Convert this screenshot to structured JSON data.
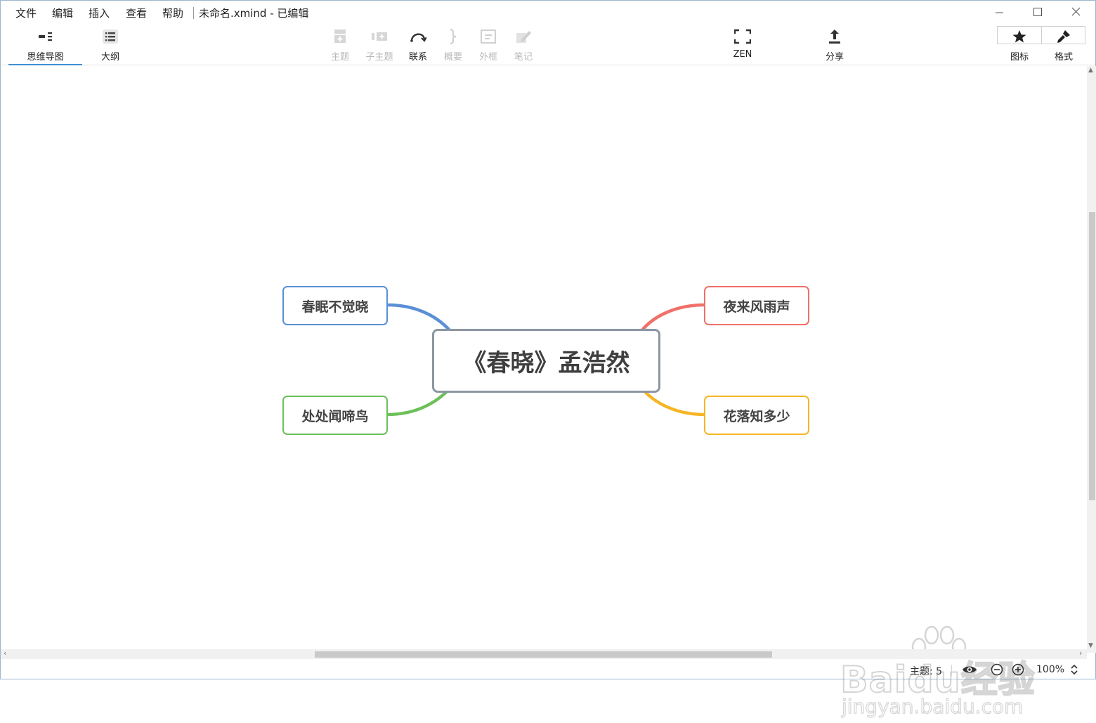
{
  "menubar": {
    "items": [
      "文件",
      "编辑",
      "插入",
      "查看",
      "帮助"
    ],
    "doc_title": "未命名.xmind - 已编辑"
  },
  "toolbar": {
    "view_tabs": [
      {
        "label": "思维导图",
        "icon": "mindmap-view-icon",
        "active": true
      },
      {
        "label": "大纲",
        "icon": "outline-list-icon",
        "active": false
      }
    ],
    "tools": [
      {
        "label": "主题",
        "icon": "add-topic-icon",
        "enabled": false
      },
      {
        "label": "子主题",
        "icon": "add-subtopic-icon",
        "enabled": false
      },
      {
        "label": "联系",
        "icon": "relationship-curve-icon",
        "enabled": true
      },
      {
        "label": "概要",
        "icon": "summary-brace-icon",
        "enabled": false
      },
      {
        "label": "外框",
        "icon": "boundary-icon",
        "enabled": false
      },
      {
        "label": "笔记",
        "icon": "note-pencil-icon",
        "enabled": false
      }
    ],
    "zen": {
      "label": "ZEN",
      "icon": "zen-fullscreen-icon"
    },
    "share": {
      "label": "分享",
      "icon": "share-upload-icon"
    },
    "right": [
      {
        "label": "图标",
        "icon": "star-icon"
      },
      {
        "label": "格式",
        "icon": "paintbrush-icon"
      }
    ]
  },
  "mindmap": {
    "central": "《春晓》孟浩然",
    "branches": [
      {
        "text": "春眠不觉晓",
        "color": "#5b8fd6"
      },
      {
        "text": "处处闻啼鸟",
        "color": "#6cc05a"
      },
      {
        "text": "夜来风雨声",
        "color": "#f0706a"
      },
      {
        "text": "花落知多少",
        "color": "#f6b526"
      }
    ]
  },
  "statusbar": {
    "topic_count": "主题: 5",
    "zoom": "100%"
  },
  "watermark": {
    "brand": "Baidu经验",
    "url": "jingyan.baidu.com"
  }
}
